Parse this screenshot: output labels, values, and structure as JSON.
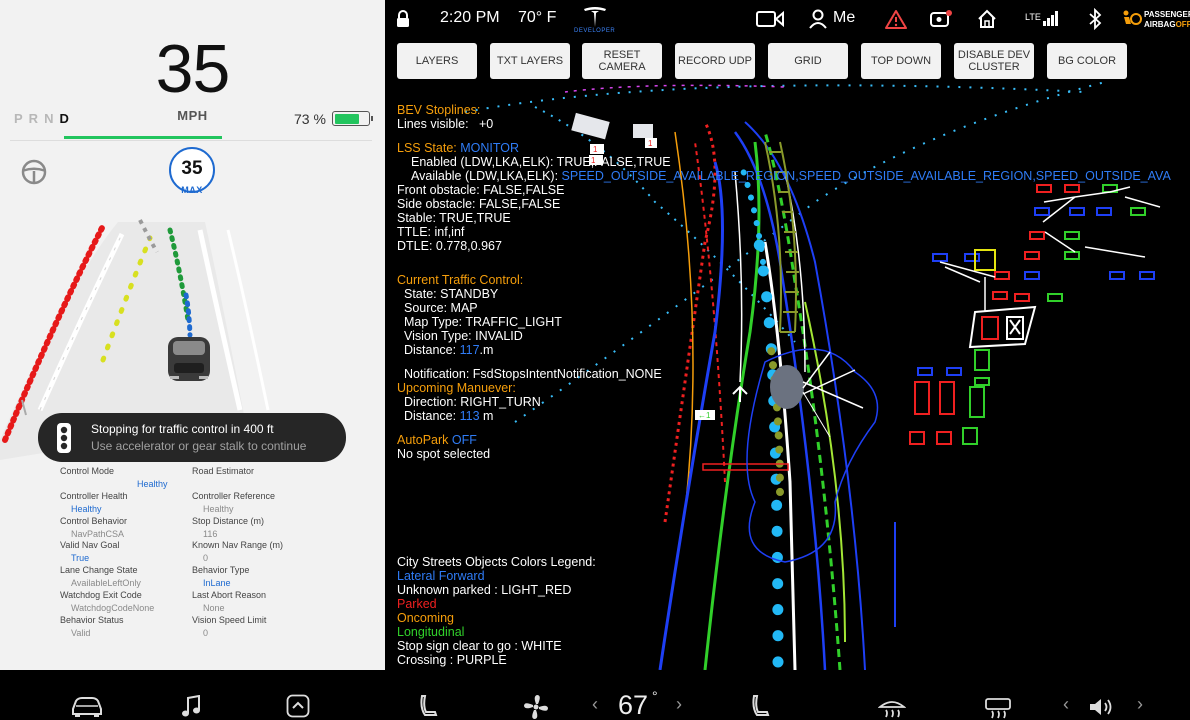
{
  "cluster": {
    "speed": "35",
    "speed_unit": "MPH",
    "gears": [
      "P",
      "R",
      "N",
      "D"
    ],
    "active_gear": "D",
    "battery_percent": "73",
    "battery_unit": "%",
    "battery_level": 0.73,
    "speed_limit": "35",
    "speed_limit_label": "MAX",
    "alert": {
      "title": "Stopping for traffic control in 400 ft",
      "subtitle": "Use accelerator or gear stalk to continue"
    },
    "stats_left": [
      {
        "label": "Control Mode",
        "value": "Healthy",
        "highlight": true
      },
      {
        "label": "Controller Health",
        "value": "Healthy",
        "highlight": true
      },
      {
        "label": "Control Behavior",
        "value": "NavPathCSA",
        "highlight": false
      },
      {
        "label": "Valid Nav Goal",
        "value": "True",
        "highlight": true
      },
      {
        "label": "Lane Change State",
        "value": "AvailableLeftOnly",
        "highlight": false
      },
      {
        "label": "Watchdog Exit Code",
        "value": "WatchdogCodeNone",
        "highlight": false
      },
      {
        "label": "Behavior Status",
        "value": "Valid",
        "highlight": false
      }
    ],
    "stats_right": [
      {
        "label": "Road Estimator",
        "value": "",
        "highlight": false
      },
      {
        "label": "Controller Reference",
        "value": "Healthy",
        "highlight": false
      },
      {
        "label": "Stop Distance (m)",
        "value": "116",
        "highlight": false
      },
      {
        "label": "Known Nav Range (m)",
        "value": "0",
        "highlight": false
      },
      {
        "label": "Behavior Type",
        "value": "InLane",
        "highlight": true
      },
      {
        "label": "Last Abort Reason",
        "value": "None",
        "highlight": false
      },
      {
        "label": "Vision Speed Limit",
        "value": "0",
        "highlight": false
      }
    ]
  },
  "status": {
    "time": "2:20 PM",
    "temp": "70° F",
    "developer": "DEVELOPER",
    "user": "Me",
    "signal": "LTE",
    "airbag_line1": "PASSENGER",
    "airbag_line2": "AIRBAG",
    "airbag_state": "OFF"
  },
  "dev_buttons": [
    {
      "label": "LAYERS"
    },
    {
      "label": "TXT LAYERS"
    },
    {
      "label": "RESET CAMERA"
    },
    {
      "label": "RECORD UDP"
    },
    {
      "label": "GRID"
    },
    {
      "label": "TOP DOWN"
    },
    {
      "label": "DISABLE DEV CLUSTER"
    },
    {
      "label": "BG COLOR"
    }
  ],
  "overlay": {
    "bev_title": "BEV Stoplines:",
    "bev_lines": "Lines visible:",
    "bev_lines_val": "+0",
    "lss_title": "LSS State:",
    "lss_state": "MONITOR",
    "lss_enabled": "Enabled (LDW,LKA,ELK): TRUE,FALSE,TRUE",
    "lss_available_label": "Available (LDW,LKA,ELK):",
    "lss_available_val": "SPEED_OUTSIDE_AVAILABLE_REGION,SPEED_OUTSIDE_AVAILABLE_REGION,SPEED_OUTSIDE_AVA",
    "front_obstacle": "Front obstacle: FALSE,FALSE",
    "side_obstacle": "Side obstacle: FALSE,FALSE",
    "stable": "Stable: TRUE,TRUE",
    "ttle": "TTLE: inf,inf",
    "dtle": "DTLE: 0.778,0.967",
    "tc_title": "Current Traffic Control:",
    "tc_state": "State: STANDBY",
    "tc_source": "Source: MAP",
    "tc_map_type": "Map Type: TRAFFIC_LIGHT",
    "tc_vision_type": "Vision Type: INVALID",
    "tc_distance_label": "Distance:",
    "tc_distance_val": "117",
    "tc_distance_unit": ".m",
    "notification": "Notification: FsdStopsIntentNotification_NONE",
    "maneuver_title": "Upcoming Manuever:",
    "maneuver_direction": "Direction: RIGHT_TURN",
    "maneuver_distance_label": "Distance:",
    "maneuver_distance_val": "113",
    "maneuver_distance_unit": "m",
    "autopark_label": "AutoPark",
    "autopark_state": "OFF",
    "autopark_spot": "No spot selected",
    "legend_title": "City Streets Objects Colors Legend:",
    "legend_lateral": "Lateral Forward",
    "legend_unknown": "Unknown parked : LIGHT_RED",
    "legend_parked": "Parked",
    "legend_oncoming": "Oncoming",
    "legend_longitudinal": "Longitudinal",
    "legend_stop": "Stop sign clear to go : WHITE",
    "legend_crossing": "Crossing : PURPLE"
  },
  "dock": {
    "temperature": "67",
    "temp_unit": "°"
  },
  "colors": {
    "accent_blue": "#2f7cf6",
    "orange": "#f59e0b",
    "green_bar": "#22c55e",
    "red": "#ef2020"
  }
}
